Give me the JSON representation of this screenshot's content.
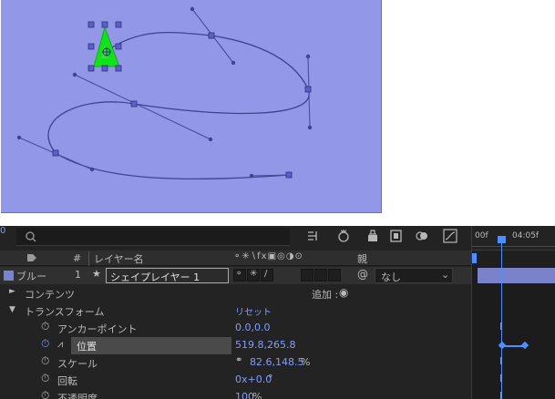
{
  "timeline": {
    "search_placeholder": "",
    "ruler_left": "00f",
    "ruler_right": "04:05f",
    "header_label_num": "#",
    "header_layer_name": "レイヤー名",
    "header_parent": "親",
    "layer": {
      "number": "1",
      "name": "シェイプレイヤー 1",
      "label_name": "ブルー",
      "parent_value": "なし"
    },
    "contents_label": "コンテンツ",
    "add_label": "追加 :",
    "transform_label": "トランスフォーム",
    "reset_label": "リセット",
    "properties": [
      {
        "label": "アンカーポイント",
        "value": "0.0,0.0",
        "suffix": ""
      },
      {
        "label": "位置",
        "value": "519.8,265.8",
        "suffix": ""
      },
      {
        "label": "スケール",
        "value": "82.6,148.5",
        "suffix": "%"
      },
      {
        "label": "回転",
        "value": "0x+0.0",
        "suffix": "°"
      },
      {
        "label": "不透明度",
        "value": "100",
        "suffix": "%"
      }
    ]
  },
  "colors": {
    "comp_background": "#9297e8",
    "shape_fill": "#11e21a",
    "path_stroke": "#3f448f",
    "value_blue": "#7f9cff",
    "timeline_bg": "#232323",
    "layer_bar": "#7a82c9",
    "playhead": "#4e8fff"
  }
}
